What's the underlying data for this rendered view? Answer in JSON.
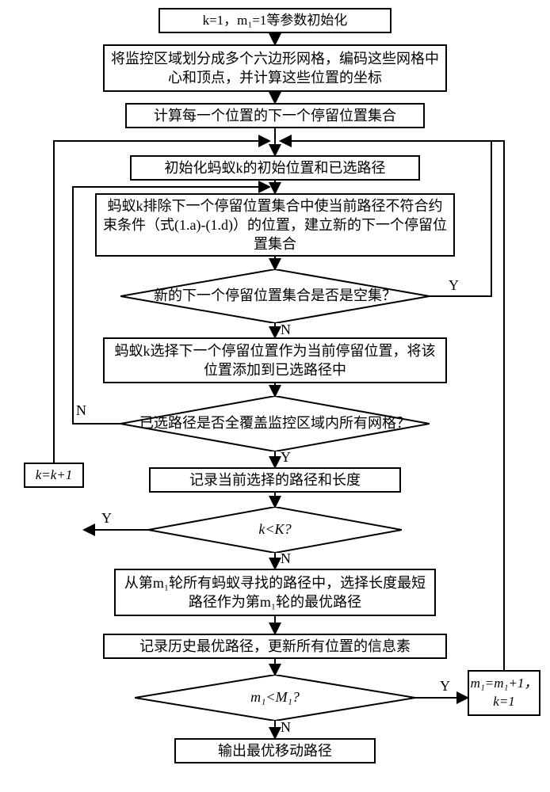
{
  "steps": {
    "s1": "k=1，m₁=1等参数初始化",
    "s2": "将监控区域划分成多个六边形网格，编码这些网格中心和顶点，并计算这些位置的坐标",
    "s3": "计算每一个位置的下一个停留位置集合",
    "s4": "初始化蚂蚁k的初始位置和已选路径",
    "s5": "蚂蚁k排除下一个停留位置集合中使当前路径不符合约束条件（式(1.a)-(1.d)）的位置，建立新的下一个停留位置集合",
    "d1": "新的下一个停留位置集合是否是空集？",
    "s6": "蚂蚁k选择下一个停留位置作为当前停留位置，将该位置添加到已选路径中",
    "d2": "已选路径是否全覆盖监控区域内所有网格？",
    "s7": "记录当前选择的路径和长度",
    "d3": "k<K?",
    "s8": "从第m₁轮所有蚂蚁寻找的路径中，选择长度最短路径作为第m₁轮的最优路径",
    "s9": "记录历史最优路径，更新所有位置的信息素",
    "d4": "m₁<M₁?",
    "s10": "输出最优移动路径",
    "inc_k": "k=k+1",
    "inc_m": "m₁=m₁+1，k=1"
  },
  "branches": {
    "yes": "Y",
    "no": "N"
  }
}
